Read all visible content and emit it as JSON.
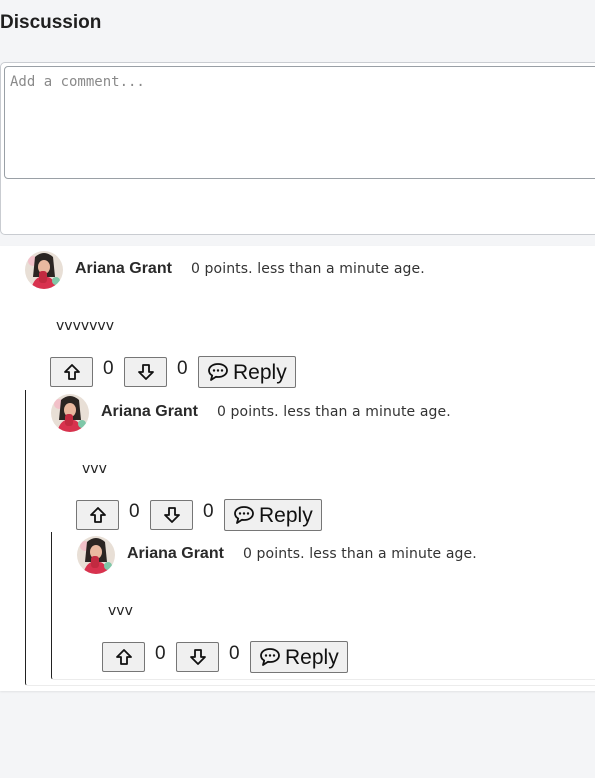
{
  "header": {
    "title": "Discussion"
  },
  "form": {
    "placeholder": "Add a comment..."
  },
  "comments": [
    {
      "author": "Ariana Grant",
      "meta": "0 points. less than a minute age.",
      "body": "vvvvvvv",
      "upvotes": "0",
      "downvotes": "0",
      "reply_label": "Reply"
    },
    {
      "author": "Ariana Grant",
      "meta": "0 points. less than a minute age.",
      "body": "vvv",
      "upvotes": "0",
      "downvotes": "0",
      "reply_label": "Reply"
    },
    {
      "author": "Ariana Grant",
      "meta": "0 points. less than a minute age.",
      "body": "vvv",
      "upvotes": "0",
      "downvotes": "0",
      "reply_label": "Reply"
    }
  ],
  "colors": {
    "border": "#767676",
    "button_bg": "#f0f0f0",
    "page_bg": "#f4f5f7"
  },
  "icons": {
    "upvote": "arrow-up-icon",
    "downvote": "arrow-down-icon",
    "reply": "speech-bubble-icon",
    "avatar": "avatar-photo"
  }
}
